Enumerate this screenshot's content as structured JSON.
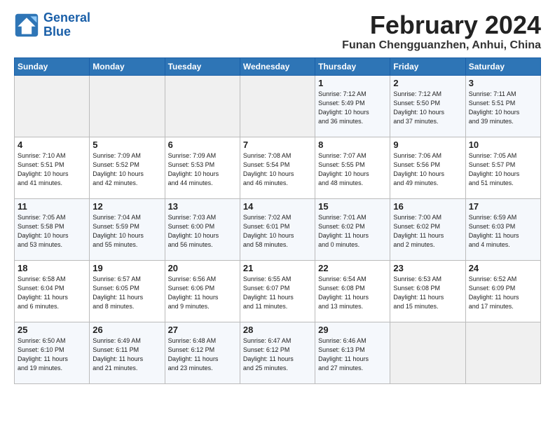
{
  "logo": {
    "line1": "General",
    "line2": "Blue"
  },
  "title": "February 2024",
  "subtitle": "Funan Chengguanzhen, Anhui, China",
  "days_of_week": [
    "Sunday",
    "Monday",
    "Tuesday",
    "Wednesday",
    "Thursday",
    "Friday",
    "Saturday"
  ],
  "weeks": [
    [
      {
        "day": "",
        "info": ""
      },
      {
        "day": "",
        "info": ""
      },
      {
        "day": "",
        "info": ""
      },
      {
        "day": "",
        "info": ""
      },
      {
        "day": "1",
        "info": "Sunrise: 7:12 AM\nSunset: 5:49 PM\nDaylight: 10 hours\nand 36 minutes."
      },
      {
        "day": "2",
        "info": "Sunrise: 7:12 AM\nSunset: 5:50 PM\nDaylight: 10 hours\nand 37 minutes."
      },
      {
        "day": "3",
        "info": "Sunrise: 7:11 AM\nSunset: 5:51 PM\nDaylight: 10 hours\nand 39 minutes."
      }
    ],
    [
      {
        "day": "4",
        "info": "Sunrise: 7:10 AM\nSunset: 5:51 PM\nDaylight: 10 hours\nand 41 minutes."
      },
      {
        "day": "5",
        "info": "Sunrise: 7:09 AM\nSunset: 5:52 PM\nDaylight: 10 hours\nand 42 minutes."
      },
      {
        "day": "6",
        "info": "Sunrise: 7:09 AM\nSunset: 5:53 PM\nDaylight: 10 hours\nand 44 minutes."
      },
      {
        "day": "7",
        "info": "Sunrise: 7:08 AM\nSunset: 5:54 PM\nDaylight: 10 hours\nand 46 minutes."
      },
      {
        "day": "8",
        "info": "Sunrise: 7:07 AM\nSunset: 5:55 PM\nDaylight: 10 hours\nand 48 minutes."
      },
      {
        "day": "9",
        "info": "Sunrise: 7:06 AM\nSunset: 5:56 PM\nDaylight: 10 hours\nand 49 minutes."
      },
      {
        "day": "10",
        "info": "Sunrise: 7:05 AM\nSunset: 5:57 PM\nDaylight: 10 hours\nand 51 minutes."
      }
    ],
    [
      {
        "day": "11",
        "info": "Sunrise: 7:05 AM\nSunset: 5:58 PM\nDaylight: 10 hours\nand 53 minutes."
      },
      {
        "day": "12",
        "info": "Sunrise: 7:04 AM\nSunset: 5:59 PM\nDaylight: 10 hours\nand 55 minutes."
      },
      {
        "day": "13",
        "info": "Sunrise: 7:03 AM\nSunset: 6:00 PM\nDaylight: 10 hours\nand 56 minutes."
      },
      {
        "day": "14",
        "info": "Sunrise: 7:02 AM\nSunset: 6:01 PM\nDaylight: 10 hours\nand 58 minutes."
      },
      {
        "day": "15",
        "info": "Sunrise: 7:01 AM\nSunset: 6:02 PM\nDaylight: 11 hours\nand 0 minutes."
      },
      {
        "day": "16",
        "info": "Sunrise: 7:00 AM\nSunset: 6:02 PM\nDaylight: 11 hours\nand 2 minutes."
      },
      {
        "day": "17",
        "info": "Sunrise: 6:59 AM\nSunset: 6:03 PM\nDaylight: 11 hours\nand 4 minutes."
      }
    ],
    [
      {
        "day": "18",
        "info": "Sunrise: 6:58 AM\nSunset: 6:04 PM\nDaylight: 11 hours\nand 6 minutes."
      },
      {
        "day": "19",
        "info": "Sunrise: 6:57 AM\nSunset: 6:05 PM\nDaylight: 11 hours\nand 8 minutes."
      },
      {
        "day": "20",
        "info": "Sunrise: 6:56 AM\nSunset: 6:06 PM\nDaylight: 11 hours\nand 9 minutes."
      },
      {
        "day": "21",
        "info": "Sunrise: 6:55 AM\nSunset: 6:07 PM\nDaylight: 11 hours\nand 11 minutes."
      },
      {
        "day": "22",
        "info": "Sunrise: 6:54 AM\nSunset: 6:08 PM\nDaylight: 11 hours\nand 13 minutes."
      },
      {
        "day": "23",
        "info": "Sunrise: 6:53 AM\nSunset: 6:08 PM\nDaylight: 11 hours\nand 15 minutes."
      },
      {
        "day": "24",
        "info": "Sunrise: 6:52 AM\nSunset: 6:09 PM\nDaylight: 11 hours\nand 17 minutes."
      }
    ],
    [
      {
        "day": "25",
        "info": "Sunrise: 6:50 AM\nSunset: 6:10 PM\nDaylight: 11 hours\nand 19 minutes."
      },
      {
        "day": "26",
        "info": "Sunrise: 6:49 AM\nSunset: 6:11 PM\nDaylight: 11 hours\nand 21 minutes."
      },
      {
        "day": "27",
        "info": "Sunrise: 6:48 AM\nSunset: 6:12 PM\nDaylight: 11 hours\nand 23 minutes."
      },
      {
        "day": "28",
        "info": "Sunrise: 6:47 AM\nSunset: 6:12 PM\nDaylight: 11 hours\nand 25 minutes."
      },
      {
        "day": "29",
        "info": "Sunrise: 6:46 AM\nSunset: 6:13 PM\nDaylight: 11 hours\nand 27 minutes."
      },
      {
        "day": "",
        "info": ""
      },
      {
        "day": "",
        "info": ""
      }
    ]
  ]
}
